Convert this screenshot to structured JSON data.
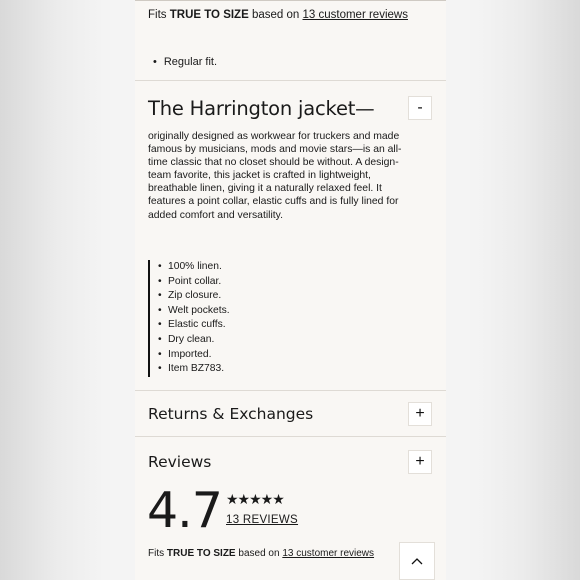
{
  "fit_top": {
    "prefix": "Fits",
    "emphasis": "TRUE TO SIZE",
    "middle": "based on",
    "link": "13 customer reviews"
  },
  "top_bullet": "Regular fit.",
  "product": {
    "title": "The Harrington jacket—",
    "collapse_label": "-",
    "description": "originally designed as workwear for truckers and made famous by musicians, mods and movie stars—is an all-time classic that no closet should be without. A design-team favorite, this jacket is crafted in lightweight, breathable linen, giving it a naturally relaxed feel. It features a point collar, elastic cuffs and is fully lined for added comfort and versatility.",
    "features": [
      "100% linen.",
      "Point collar.",
      "Zip closure.",
      "Welt pockets.",
      "Elastic cuffs.",
      "Dry clean.",
      "Imported.",
      "Item BZ783."
    ]
  },
  "returns": {
    "label": "Returns & Exchanges",
    "expand_label": "+"
  },
  "reviews": {
    "label": "Reviews",
    "expand_label": "+",
    "rating": "4.7",
    "stars": "★★★★★",
    "count_link": "13 REVIEWS"
  },
  "fit_bottom": {
    "prefix": "Fits",
    "emphasis": "TRUE TO SIZE",
    "middle": "based on",
    "link": "13 customer reviews"
  },
  "icons": {
    "scroll_top": "chevron-up-icon"
  }
}
